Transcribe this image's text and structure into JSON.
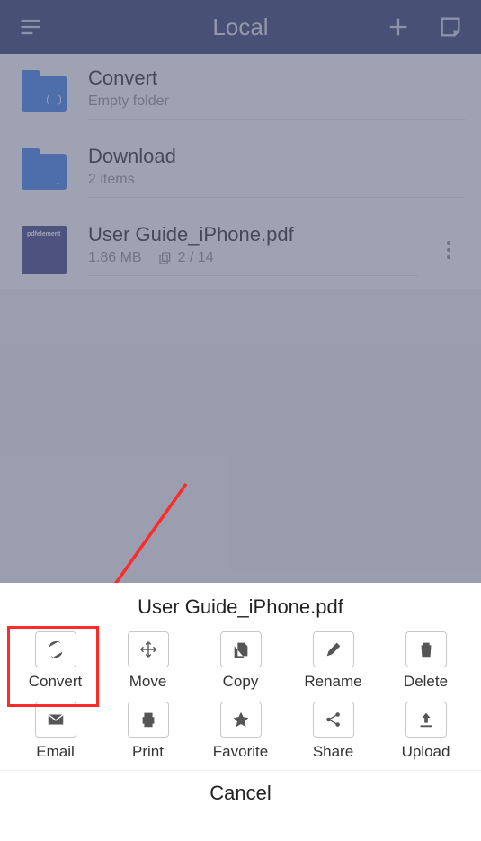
{
  "header": {
    "title": "Local"
  },
  "files": [
    {
      "name": "Convert",
      "meta": "Empty folder"
    },
    {
      "name": "Download",
      "meta": "2 items"
    },
    {
      "name": "User Guide_iPhone.pdf",
      "size": "1.86 MB",
      "pages": "2 / 14"
    }
  ],
  "sheet": {
    "title": "User Guide_iPhone.pdf",
    "actions": [
      {
        "label": "Convert"
      },
      {
        "label": "Move"
      },
      {
        "label": "Copy"
      },
      {
        "label": "Rename"
      },
      {
        "label": "Delete"
      },
      {
        "label": "Email"
      },
      {
        "label": "Print"
      },
      {
        "label": "Favorite"
      },
      {
        "label": "Share"
      },
      {
        "label": "Upload"
      }
    ],
    "cancel": "Cancel"
  }
}
